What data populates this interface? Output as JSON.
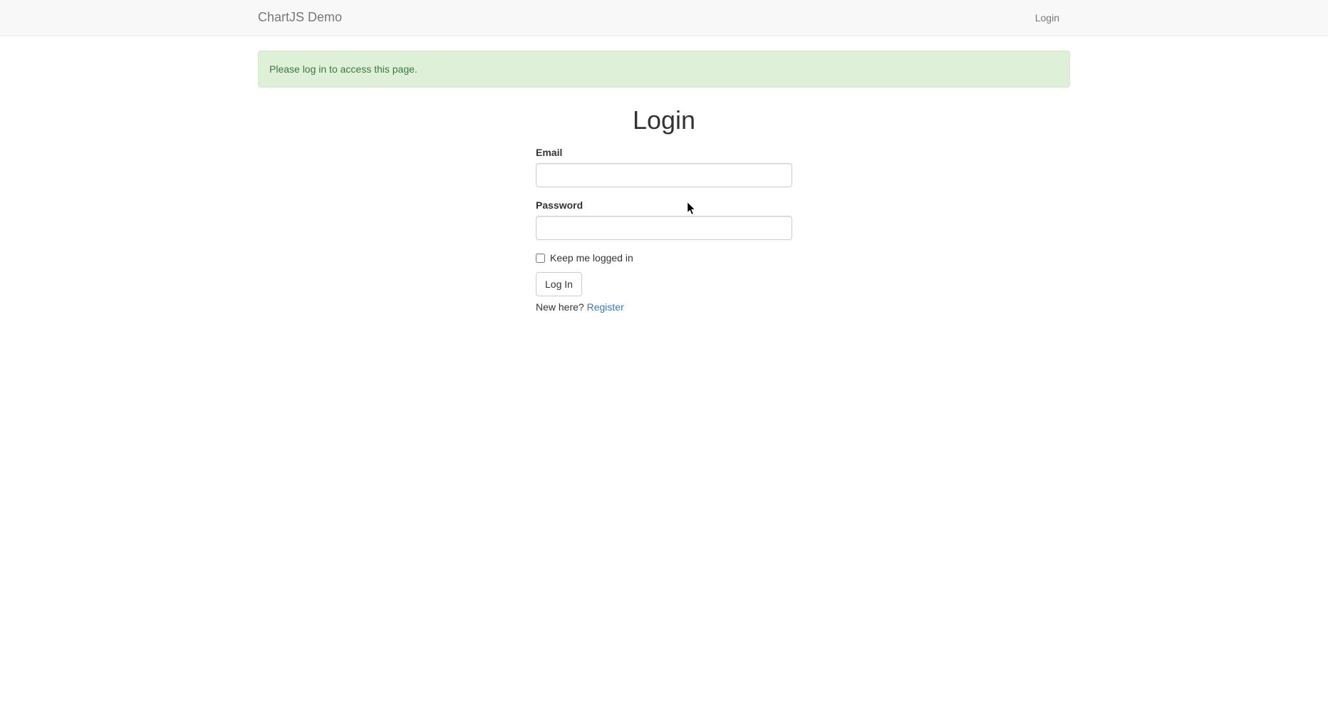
{
  "navbar": {
    "brand": "ChartJS Demo",
    "login_link": "Login"
  },
  "alert": {
    "message": "Please log in to access this page."
  },
  "form": {
    "title": "Login",
    "email_label": "Email",
    "password_label": "Password",
    "remember_label": "Keep me logged in",
    "submit_label": "Log In",
    "register_prompt": "New here? ",
    "register_link": "Register"
  }
}
